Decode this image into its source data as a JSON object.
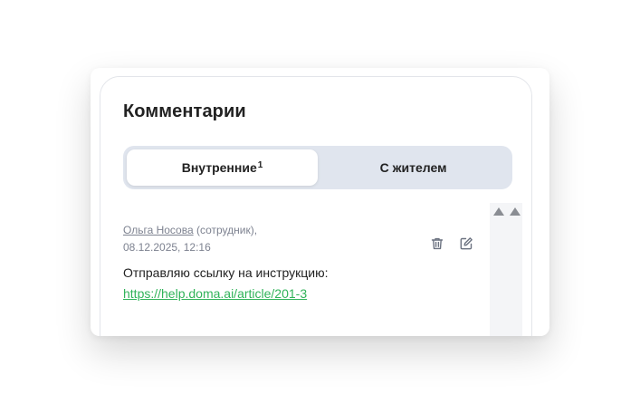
{
  "panel": {
    "title": "Комментарии"
  },
  "tabs": [
    {
      "label": "Внутренние",
      "badge": "1",
      "active": true
    },
    {
      "label": "С жителем",
      "badge": "",
      "active": false
    }
  ],
  "comment": {
    "author": "Ольга Носова",
    "role": "(сотрудник),",
    "date": "08.12.2025, 12:16",
    "text": "Отправляю ссылку на инструкцию:",
    "link": "https://help.doma.ai/article/201-3"
  },
  "icons": {
    "delete": "trash-icon",
    "edit": "edit-icon",
    "scroll_up": "triangle-up-icon"
  },
  "colors": {
    "accent_link": "#31b35a",
    "tab_track": "#e0e5ee",
    "muted_text": "#7d8290",
    "icon": "#6b7280"
  }
}
